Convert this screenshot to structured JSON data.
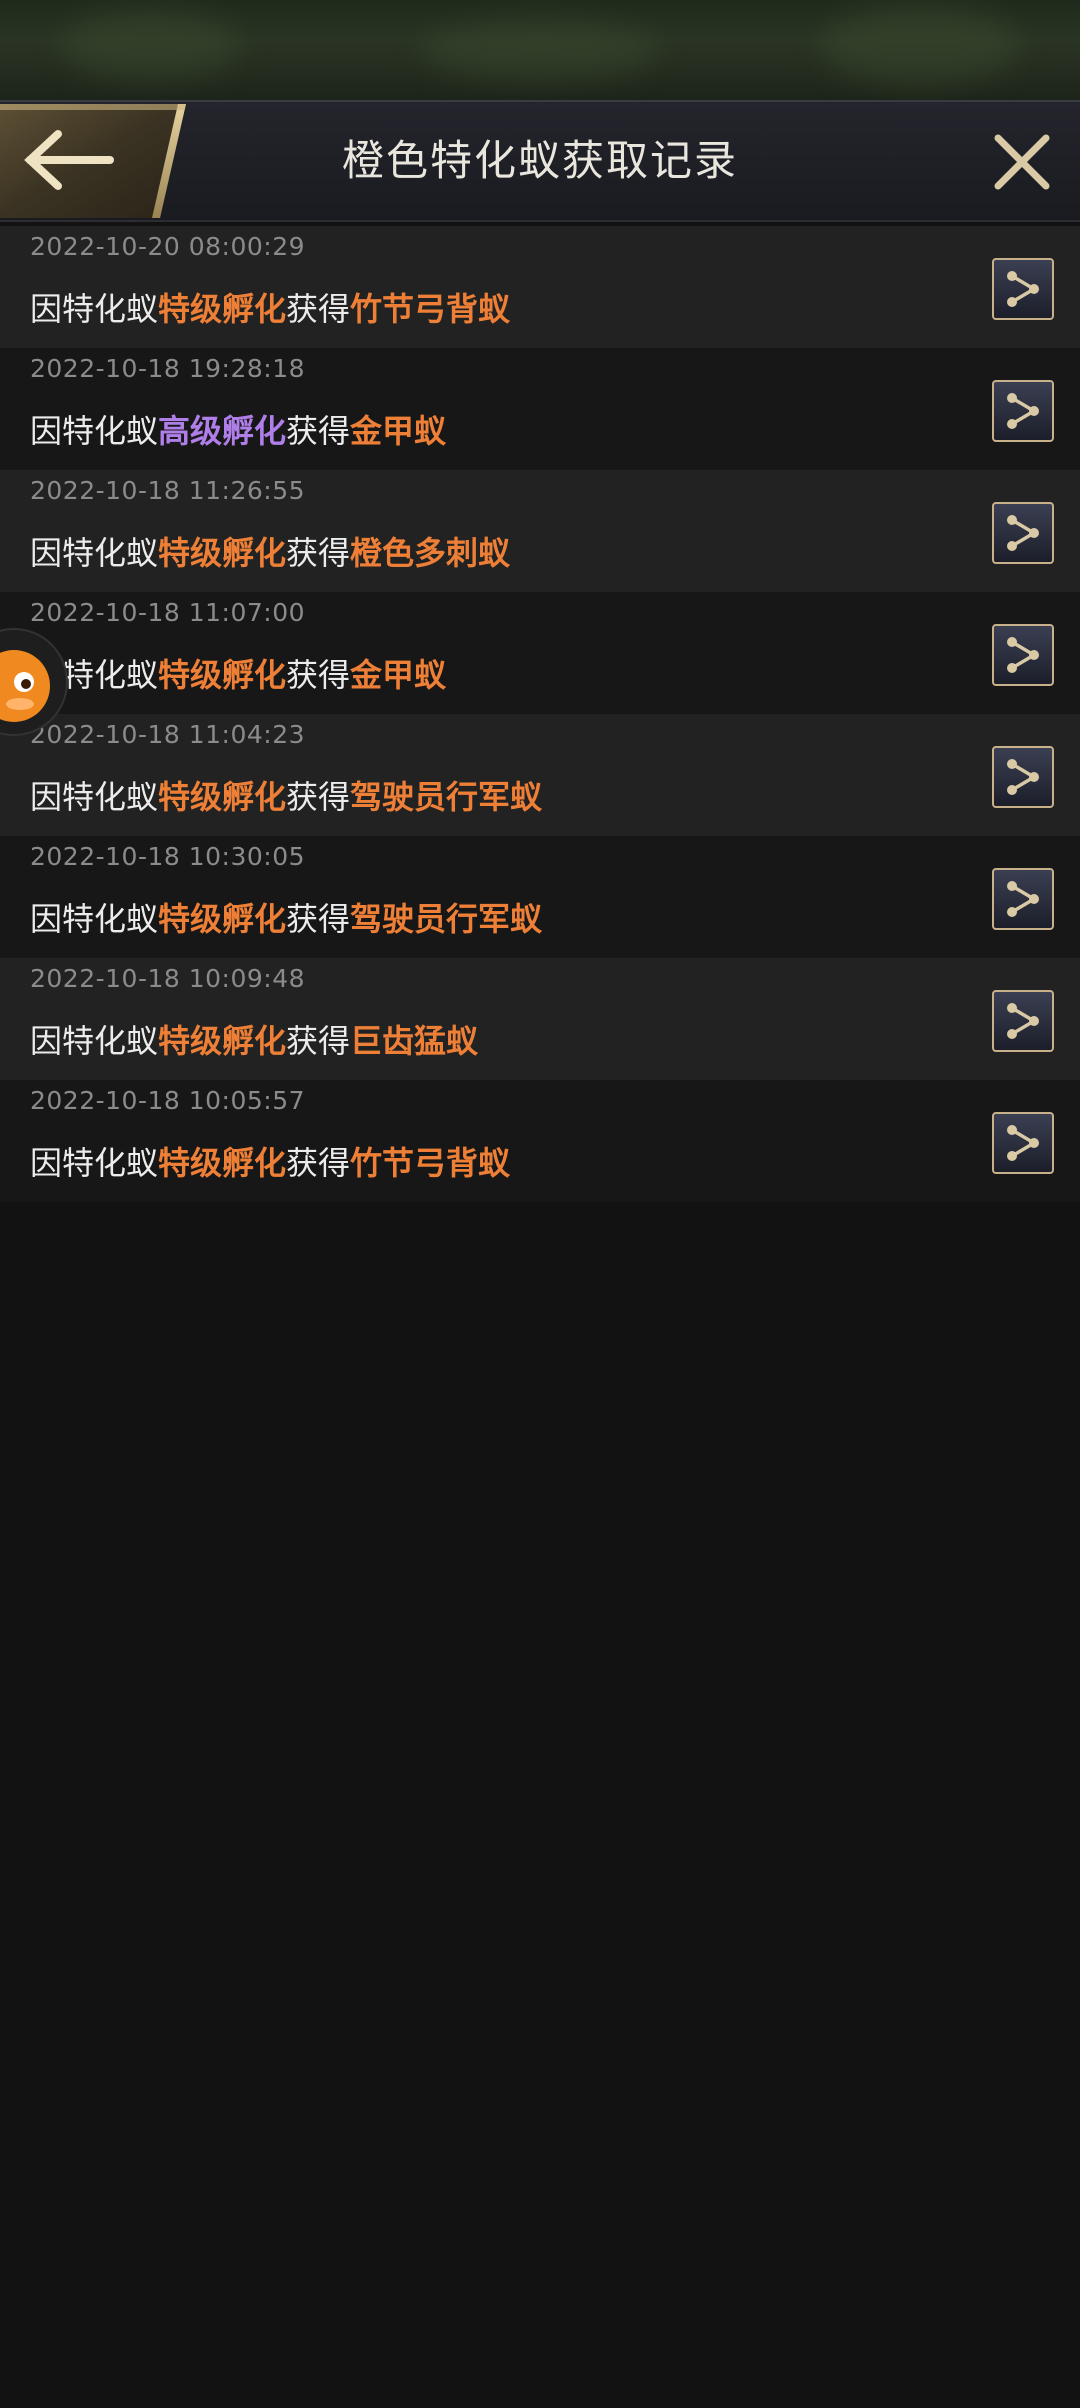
{
  "header": {
    "title": "橙色特化蚁获取记录"
  },
  "records": [
    {
      "time": "2022-10-20 08:00:29",
      "prefix": "因特化蚁",
      "method": "特级孵化",
      "method_color": "#ee7f36",
      "mid": "获得",
      "item": "竹节弓背蚁",
      "item_color": "#ee7f36"
    },
    {
      "time": "2022-10-18 19:28:18",
      "prefix": "因特化蚁",
      "method": "高级孵化",
      "method_color": "#b07ee8",
      "mid": "获得",
      "item": "金甲蚁",
      "item_color": "#ee7f36"
    },
    {
      "time": "2022-10-18 11:26:55",
      "prefix": "因特化蚁",
      "method": "特级孵化",
      "method_color": "#ee7f36",
      "mid": "获得",
      "item": "橙色多刺蚁",
      "item_color": "#ee7f36"
    },
    {
      "time": "2022-10-18 11:07:00",
      "prefix": "因特化蚁",
      "method": "特级孵化",
      "method_color": "#ee7f36",
      "mid": "获得",
      "item": "金甲蚁",
      "item_color": "#ee7f36"
    },
    {
      "time": "2022-10-18 11:04:23",
      "prefix": "因特化蚁",
      "method": "特级孵化",
      "method_color": "#ee7f36",
      "mid": "获得",
      "item": "驾驶员行军蚁",
      "item_color": "#ee7f36"
    },
    {
      "time": "2022-10-18 10:30:05",
      "prefix": "因特化蚁",
      "method": "特级孵化",
      "method_color": "#ee7f36",
      "mid": "获得",
      "item": "驾驶员行军蚁",
      "item_color": "#ee7f36"
    },
    {
      "time": "2022-10-18 10:09:48",
      "prefix": "因特化蚁",
      "method": "特级孵化",
      "method_color": "#ee7f36",
      "mid": "获得",
      "item": "巨齿猛蚁",
      "item_color": "#ee7f36"
    },
    {
      "time": "2022-10-18 10:05:57",
      "prefix": "因特化蚁",
      "method": "特级孵化",
      "method_color": "#ee7f36",
      "mid": "获得",
      "item": "竹节弓背蚁",
      "item_color": "#ee7f36"
    }
  ],
  "colors": {
    "accent_gold": "#c7b08a",
    "orange": "#ee7f36",
    "purple": "#b07ee8",
    "background": "#121212"
  },
  "icons": {
    "back": "back-arrow-icon",
    "close": "close-icon",
    "share": "share-icon"
  }
}
